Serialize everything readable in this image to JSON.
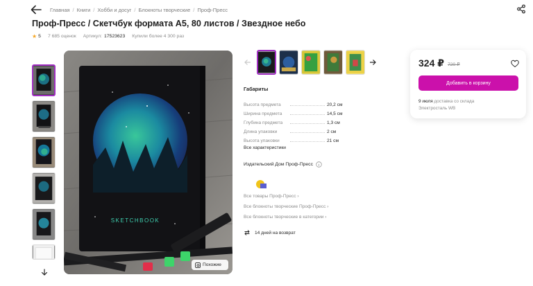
{
  "breadcrumb": [
    "Главная",
    "Книги",
    "Хобби и досуг",
    "Блокноты творческие",
    "Проф-Пресс"
  ],
  "product": {
    "title": "Проф-Пресс / Скетчбук формата А5, 80 листов / Звездное небо",
    "rating": "5",
    "reviews": "7 685 оценок",
    "article_label": "Артикул:",
    "article": "17523623",
    "bought": "Купили более 4 300 раз",
    "cover_text": "SKETCHBOOK"
  },
  "similar_label": "Похожие",
  "specs": {
    "heading": "Габариты",
    "rows": [
      {
        "k": "Высота предмета",
        "v": "20,2 см"
      },
      {
        "k": "Ширина предмета",
        "v": "14,5 см"
      },
      {
        "k": "Глубина предмета",
        "v": "1,3 см"
      },
      {
        "k": "Длина упаковки",
        "v": "2 см"
      },
      {
        "k": "Высота упаковки",
        "v": "21 см"
      }
    ],
    "all_link": "Все характеристики"
  },
  "seller": {
    "name": "Издательский Дом Проф-Пресс",
    "links": [
      "Все товары Проф-Пресс",
      "Все блокноты творческие Проф-Пресс",
      "Все блокноты творческие в категории"
    ],
    "returns": "14 дней на возврат"
  },
  "buy": {
    "price": "324 ₽",
    "old_price": "720 ₽",
    "cart_label": "Добавить в корзину",
    "delivery_date": "9 июля",
    "delivery_text": "доставка со склада",
    "warehouse": "Электросталь WB"
  },
  "colors": {
    "accent": "#cb11ab",
    "thumb_border": "#a12ec2",
    "star": "#f5a623"
  },
  "icons": [
    "back-arrow-icon",
    "share-icon",
    "star-icon",
    "heart-icon",
    "info-icon",
    "return-icon",
    "chevron-down-icon",
    "similar-icon"
  ]
}
